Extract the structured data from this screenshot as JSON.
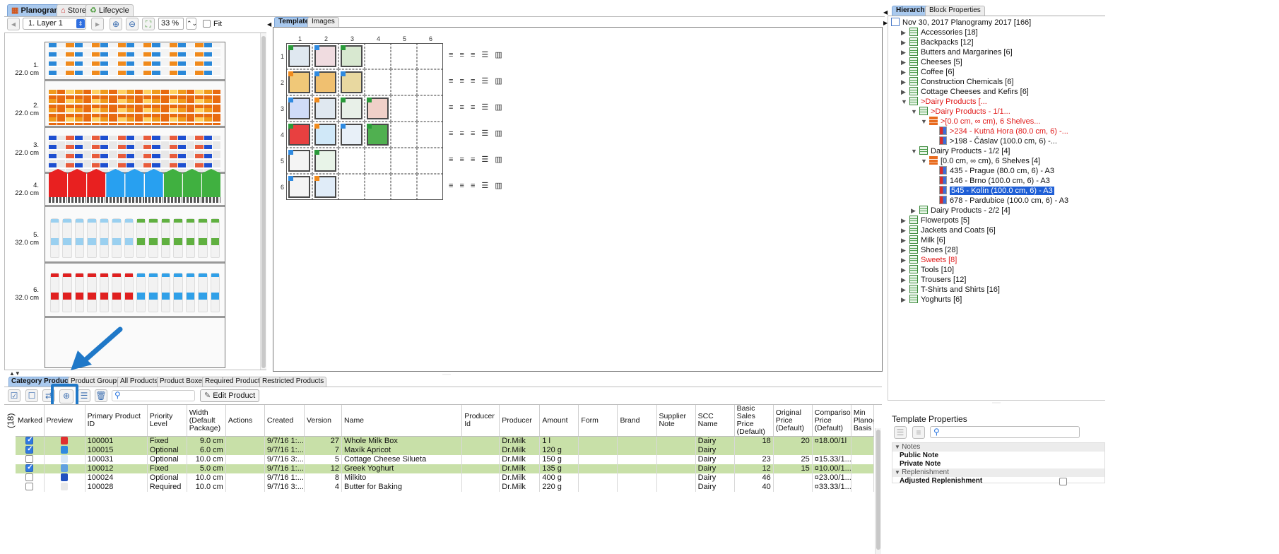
{
  "main_tabs": [
    "Planogram",
    "Store",
    "Lifecycle"
  ],
  "layer_select": "1. Layer 1",
  "zoom": "33 %",
  "fit_label": "Fit",
  "shelves": [
    {
      "label": "1.",
      "height": "22.0 cm"
    },
    {
      "label": "2.",
      "height": "22.0 cm"
    },
    {
      "label": "3.",
      "height": "22.0 cm"
    },
    {
      "label": "4.",
      "height": "22.0 cm"
    },
    {
      "label": "5.",
      "height": "32.0 cm"
    },
    {
      "label": "6.",
      "height": "32.0 cm"
    }
  ],
  "center_tabs": [
    "Template",
    "Images"
  ],
  "template_columns": [
    "1",
    "2",
    "3",
    "4",
    "5",
    "6"
  ],
  "template_rows": [
    "1",
    "2",
    "3",
    "4",
    "5",
    "6"
  ],
  "right_tabs": [
    "Hierarchy",
    "Block Properties"
  ],
  "tree": [
    {
      "t": "Nov 30, 2017 Planogramy 2017 [166]"
    },
    {
      "t": "Accessories [18]"
    },
    {
      "t": "Backpacks [12]"
    },
    {
      "t": "Butters and Margarines [6]"
    },
    {
      "t": "Cheeses [5]"
    },
    {
      "t": "Coffee [6]"
    },
    {
      "t": "Construction Chemicals [6]"
    },
    {
      "t": "Cottage Cheeses and Kefirs [6]"
    },
    {
      "t": ">Dairy Products [..."
    },
    {
      "t": ">Dairy Products - 1/1..."
    },
    {
      "t": ">[0.0 cm, ∞ cm), 6 Shelves..."
    },
    {
      "t": ">234 - Kutná Hora (80.0 cm, 6) -..."
    },
    {
      "t": ">198 - Čáslav (100.0 cm, 6) -..."
    },
    {
      "t": "Dairy Products - 1/2 [4]"
    },
    {
      "t": "[0.0 cm, ∞ cm), 6 Shelves [4]"
    },
    {
      "t": "435 - Prague (80.0 cm, 6) - A3"
    },
    {
      "t": "146 - Brno (100.0 cm, 6) - A3"
    },
    {
      "t": "545 - Kolín (100.0 cm, 6) - A3"
    },
    {
      "t": "678 - Pardubice (100.0 cm, 6) - A3"
    },
    {
      "t": "Dairy Products - 2/2 [4]"
    },
    {
      "t": "Flowerpots [5]"
    },
    {
      "t": "Jackets and Coats [6]"
    },
    {
      "t": "Milk [6]"
    },
    {
      "t": "Shoes [28]"
    },
    {
      "t": "Sweets [8]"
    },
    {
      "t": "Tools [10]"
    },
    {
      "t": "Trousers [12]"
    },
    {
      "t": "T-Shirts and Shirts [16]"
    },
    {
      "t": "Yoghurts [6]"
    }
  ],
  "bottom_tabs": [
    "Category Products",
    "Product Groups",
    "All Products",
    "Product Boxes",
    "Required Products",
    "Restricted Products"
  ],
  "edit_product": "Edit Product",
  "search_placeholder": "",
  "row_count": "(18)",
  "columns": [
    "Marked",
    "Preview",
    "Primary Product ID",
    "Priority Level",
    "Width (Default Package)",
    "Actions",
    "Created",
    "Version",
    "Name",
    "Producer Id",
    "Producer",
    "Amount",
    "Form",
    "Brand",
    "Supplier Note",
    "SCC Name",
    "Basic Sales Price (Default)",
    "Original Price (Default)",
    "Comparison Price (Default)",
    "Min Planogram Basis"
  ],
  "rows": [
    {
      "id": "100001",
      "priority": "Fixed",
      "width": "9.0 cm",
      "created": "9/7/16 1:...",
      "version": "27",
      "name": "Whole Milk Box",
      "producer": "Dr.Milk",
      "amount": "1 l",
      "scc": "Dairy",
      "basic": "18",
      "orig": "20",
      "comp": "¤18.00/1l"
    },
    {
      "id": "100015",
      "priority": "Optional",
      "width": "6.0 cm",
      "created": "9/7/16 1:...",
      "version": "7",
      "name": "Maxík Apricot",
      "producer": "Dr.Milk",
      "amount": "120 g",
      "scc": "Dairy",
      "basic": "",
      "orig": "",
      "comp": ""
    },
    {
      "id": "100031",
      "priority": "Optional",
      "width": "10.0 cm",
      "created": "9/7/16 3:...",
      "version": "5",
      "name": "Cottage Cheese Silueta",
      "producer": "Dr.Milk",
      "amount": "150 g",
      "scc": "Dairy",
      "basic": "23",
      "orig": "25",
      "comp": "¤15.33/1..."
    },
    {
      "id": "100012",
      "priority": "Fixed",
      "width": "5.0 cm",
      "created": "9/7/16 1:...",
      "version": "12",
      "name": "Greek Yoghurt",
      "producer": "Dr.Milk",
      "amount": "135 g",
      "scc": "Dairy",
      "basic": "12",
      "orig": "15",
      "comp": "¤10.00/1..."
    },
    {
      "id": "100024",
      "priority": "Optional",
      "width": "10.0 cm",
      "created": "9/7/16 1:...",
      "version": "8",
      "name": "Milkito",
      "producer": "Dr.Milk",
      "amount": "400 g",
      "scc": "Dairy",
      "basic": "46",
      "orig": "",
      "comp": "¤23.00/1..."
    },
    {
      "id": "100028",
      "priority": "Required",
      "width": "10.0 cm",
      "created": "9/7/16 3:...",
      "version": "4",
      "name": "Butter for Baking",
      "producer": "Dr.Milk",
      "amount": "220 g",
      "scc": "Dairy",
      "basic": "40",
      "orig": "",
      "comp": "¤33.33/1..."
    }
  ],
  "template_properties": {
    "title": "Template Properties",
    "groups": [
      {
        "name": "Notes",
        "items": [
          "Public Note",
          "Private Note"
        ]
      },
      {
        "name": "Replenishment",
        "items": [
          "Adjusted Replenishment"
        ]
      }
    ]
  },
  "colors": {
    "accent": "#1f78c8",
    "selected": "#1f5fd6",
    "marked_row": "#c8e0a8",
    "red_text": "#e01b1b"
  }
}
